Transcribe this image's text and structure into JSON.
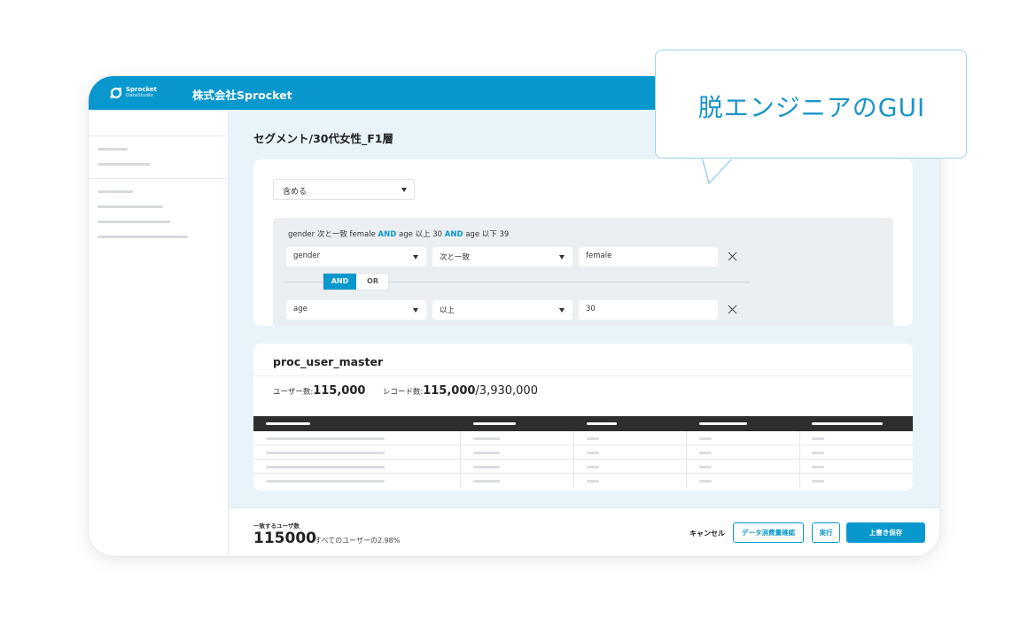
{
  "app": {
    "logo_name": "Sprocket",
    "logo_sub": "DataStudio",
    "company": "株式会社Sprocket"
  },
  "callout": "脱エンジニアのGUI",
  "segment": {
    "title": "セグメント/30代女性_F1層",
    "include_select": "含める"
  },
  "conditions": {
    "summary_parts": [
      "gender 次と一致 female ",
      "AND",
      " age 以上 30 ",
      "AND",
      " age 以下 39"
    ],
    "rows": [
      {
        "field": "gender",
        "operator": "次と一致",
        "value": "female"
      },
      {
        "field": "age",
        "operator": "以上",
        "value": "30"
      }
    ],
    "connector": {
      "and_label": "AND",
      "or_label": "OR",
      "selected": "AND"
    }
  },
  "table": {
    "name": "proc_user_master",
    "users_label": "ユーザー数:",
    "users_value": "115,000",
    "records_label": "レコード数:",
    "records_value": "115,000",
    "records_total": "/3,930,000"
  },
  "footer": {
    "match_label": "一致するユーザ数",
    "match_count": "115000",
    "match_percent": "すべてのユーザーの2.98%",
    "cancel_label": "キャンセル",
    "check_label": "データ消費量確認",
    "run_label": "実行",
    "save_label": "上書き保存"
  },
  "colors": {
    "accent": "#0898cd",
    "background": "#e9f4fa",
    "table_header": "#2e2e2e"
  },
  "icons": [
    "sprocket-logo-icon",
    "chevron-down-icon",
    "close-icon"
  ]
}
